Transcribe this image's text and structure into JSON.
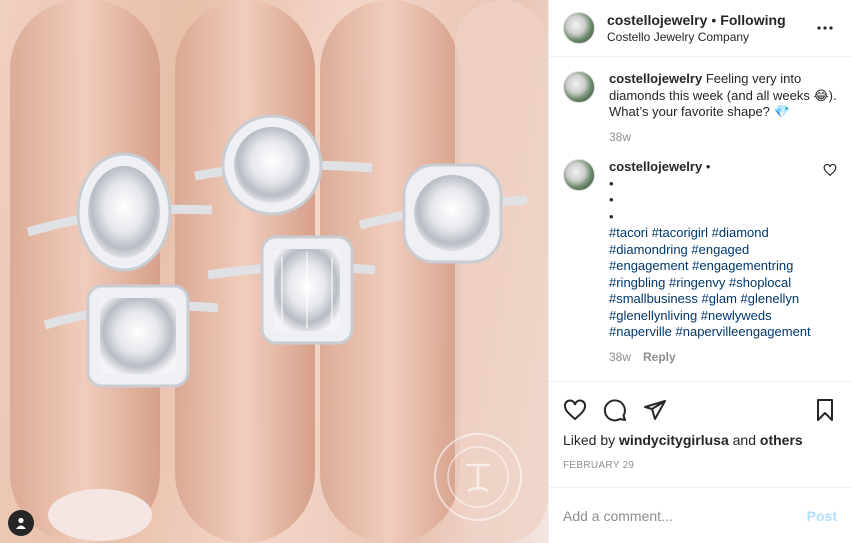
{
  "header": {
    "username": "costellojewelry",
    "separator": "•",
    "follow_state": "Following",
    "location": "Costello Jewelry Company",
    "more_icon": "more-horizontal-icon"
  },
  "caption": {
    "username": "costellojewelry",
    "text": "Feeling very into diamonds this week (and all weeks 😂). What’s your favorite shape? 💎",
    "time": "38w"
  },
  "comment": {
    "username": "costellojewelry",
    "separator": "•",
    "bullets": [
      "•",
      "•",
      "•"
    ],
    "hashtags": [
      "#tacori",
      "#tacorigirl",
      "#diamond",
      "#diamondring",
      "#engaged",
      "#engagement",
      "#engagementring",
      "#ringbling",
      "#ringenvy",
      "#shoplocal",
      "#smallbusiness",
      "#glam",
      "#glenellyn",
      "#glenellynliving",
      "#newlyweds",
      "#naperville",
      "#napervilleengagement"
    ],
    "time": "38w",
    "reply_label": "Reply"
  },
  "actions": {
    "icons": [
      "heart-icon",
      "comment-icon",
      "share-icon",
      "bookmark-icon"
    ],
    "likes_prefix": "Liked by",
    "likes_user": "windycitygirlusa",
    "likes_and": "and",
    "likes_others": "others",
    "date": "FEBRUARY 29"
  },
  "add_comment": {
    "placeholder": "Add a comment...",
    "post_label": "Post"
  },
  "colors": {
    "text": "#262626",
    "muted": "#8e8e8e",
    "link": "#00376b",
    "post_disabled": "#b2dffc",
    "border": "#efefef"
  }
}
